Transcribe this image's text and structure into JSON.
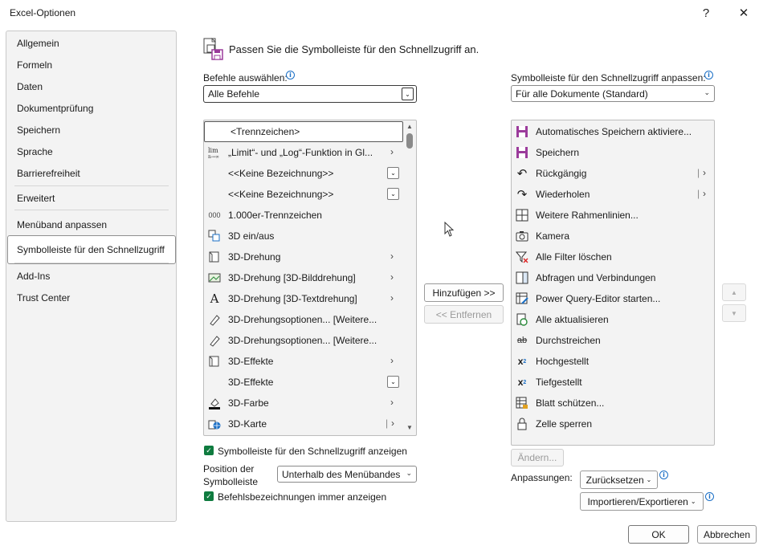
{
  "window": {
    "title": "Excel-Optionen",
    "help_label": "?",
    "close_label": "✕"
  },
  "nav": {
    "items": [
      {
        "label": "Allgemein"
      },
      {
        "label": "Formeln"
      },
      {
        "label": "Daten"
      },
      {
        "label": "Dokumentprüfung"
      },
      {
        "label": "Speichern"
      },
      {
        "label": "Sprache"
      },
      {
        "label": "Barrierefreiheit"
      },
      {
        "label": "Erweitert"
      },
      {
        "label": "Menüband anpassen"
      },
      {
        "label": "Symbolleiste für den Schnellzugriff"
      },
      {
        "label": "Add-Ins"
      },
      {
        "label": "Trust Center"
      }
    ],
    "selected": "Symbolleiste für den Schnellzugriff"
  },
  "header": {
    "text": "Passen Sie die Symbolleiste für den Schnellzugriff an."
  },
  "left": {
    "label": "Befehle auswählen:",
    "combo_value": "Alle Befehle",
    "commands": [
      {
        "label": "<Trennzeichen>",
        "icon": "none",
        "suffix": "none"
      },
      {
        "label": "„Limit“- und „Log“-Funktion in Gl...",
        "icon": "lim-icon",
        "suffix": "arrow"
      },
      {
        "label": "<<Keine Bezeichnung>>",
        "icon": "none",
        "suffix": "dropdown"
      },
      {
        "label": "<<Keine Bezeichnung>>",
        "icon": "none",
        "suffix": "dropdown"
      },
      {
        "label": "1.000er-Trennzeichen",
        "icon": "thousands-icon",
        "suffix": "none"
      },
      {
        "label": "3D ein/aus",
        "icon": "3d-toggle-icon",
        "suffix": "none"
      },
      {
        "label": "3D-Drehung",
        "icon": "cube-icon",
        "suffix": "arrow"
      },
      {
        "label": "3D-Drehung [3D-Bilddrehung]",
        "icon": "picture-rotate-icon",
        "suffix": "arrow"
      },
      {
        "label": "3D-Drehung [3D-Textdrehung]",
        "icon": "text-rotate-icon",
        "suffix": "arrow"
      },
      {
        "label": "3D-Drehungsoptionen... [Weitere...",
        "icon": "pen-options-icon",
        "suffix": "none"
      },
      {
        "label": "3D-Drehungsoptionen... [Weitere...",
        "icon": "pen-options-icon",
        "suffix": "none"
      },
      {
        "label": "3D-Effekte",
        "icon": "cube-icon",
        "suffix": "arrow"
      },
      {
        "label": "3D-Effekte",
        "icon": "none",
        "suffix": "dropdown"
      },
      {
        "label": "3D-Farbe",
        "icon": "fill-color-icon",
        "suffix": "arrow"
      },
      {
        "label": "3D-Karte",
        "icon": "map-icon",
        "suffix": "split-arrow"
      }
    ],
    "show_qat_label": "Symbolleiste für den Schnellzugriff anzeigen",
    "position_label_line1": "Position der",
    "position_label_line2": "Symbolleiste",
    "position_value": "Unterhalb des Menübandes",
    "always_labels_label": "Befehlsbezeichnungen immer anzeigen"
  },
  "middle": {
    "add_label": "Hinzufügen >>",
    "remove_label": "<< Entfernen"
  },
  "right": {
    "label": "Symbolleiste für den Schnellzugriff anpassen:",
    "combo_value": "Für alle Dokumente (Standard)",
    "items": [
      {
        "label": "Automatisches Speichern aktiviere...",
        "icon": "autosave-icon",
        "suffix": "none"
      },
      {
        "label": "Speichern",
        "icon": "save-icon",
        "suffix": "none"
      },
      {
        "label": "Rückgängig",
        "icon": "undo-icon",
        "suffix": "split-arrow"
      },
      {
        "label": "Wiederholen",
        "icon": "redo-icon",
        "suffix": "split-arrow"
      },
      {
        "label": "Weitere Rahmenlinien...",
        "icon": "borders-icon",
        "suffix": "none"
      },
      {
        "label": "Kamera",
        "icon": "camera-icon",
        "suffix": "none"
      },
      {
        "label": "Alle Filter löschen",
        "icon": "clear-filter-icon",
        "suffix": "none"
      },
      {
        "label": "Abfragen und Verbindungen",
        "icon": "queries-icon",
        "suffix": "none"
      },
      {
        "label": "Power Query-Editor starten...",
        "icon": "power-query-icon",
        "suffix": "none"
      },
      {
        "label": "Alle aktualisieren",
        "icon": "refresh-icon",
        "suffix": "none"
      },
      {
        "label": "Durchstreichen",
        "icon": "strikethrough-icon",
        "suffix": "none"
      },
      {
        "label": "Hochgestellt",
        "icon": "superscript-icon",
        "suffix": "none"
      },
      {
        "label": "Tiefgestellt",
        "icon": "subscript-icon",
        "suffix": "none"
      },
      {
        "label": "Blatt schützen...",
        "icon": "protect-sheet-icon",
        "suffix": "none"
      },
      {
        "label": "Zelle sperren",
        "icon": "lock-icon",
        "suffix": "none"
      }
    ],
    "modify_label": "Ändern...",
    "customizations_label": "Anpassungen:",
    "reset_label": "Zurücksetzen",
    "import_export_label": "Importieren/Exportieren"
  },
  "footer": {
    "ok_label": "OK",
    "cancel_label": "Abbrechen"
  },
  "colors": {
    "accent_green": "#0f7b3f",
    "save_purple": "#9b3b9b",
    "info_blue": "#1a6fc6"
  }
}
